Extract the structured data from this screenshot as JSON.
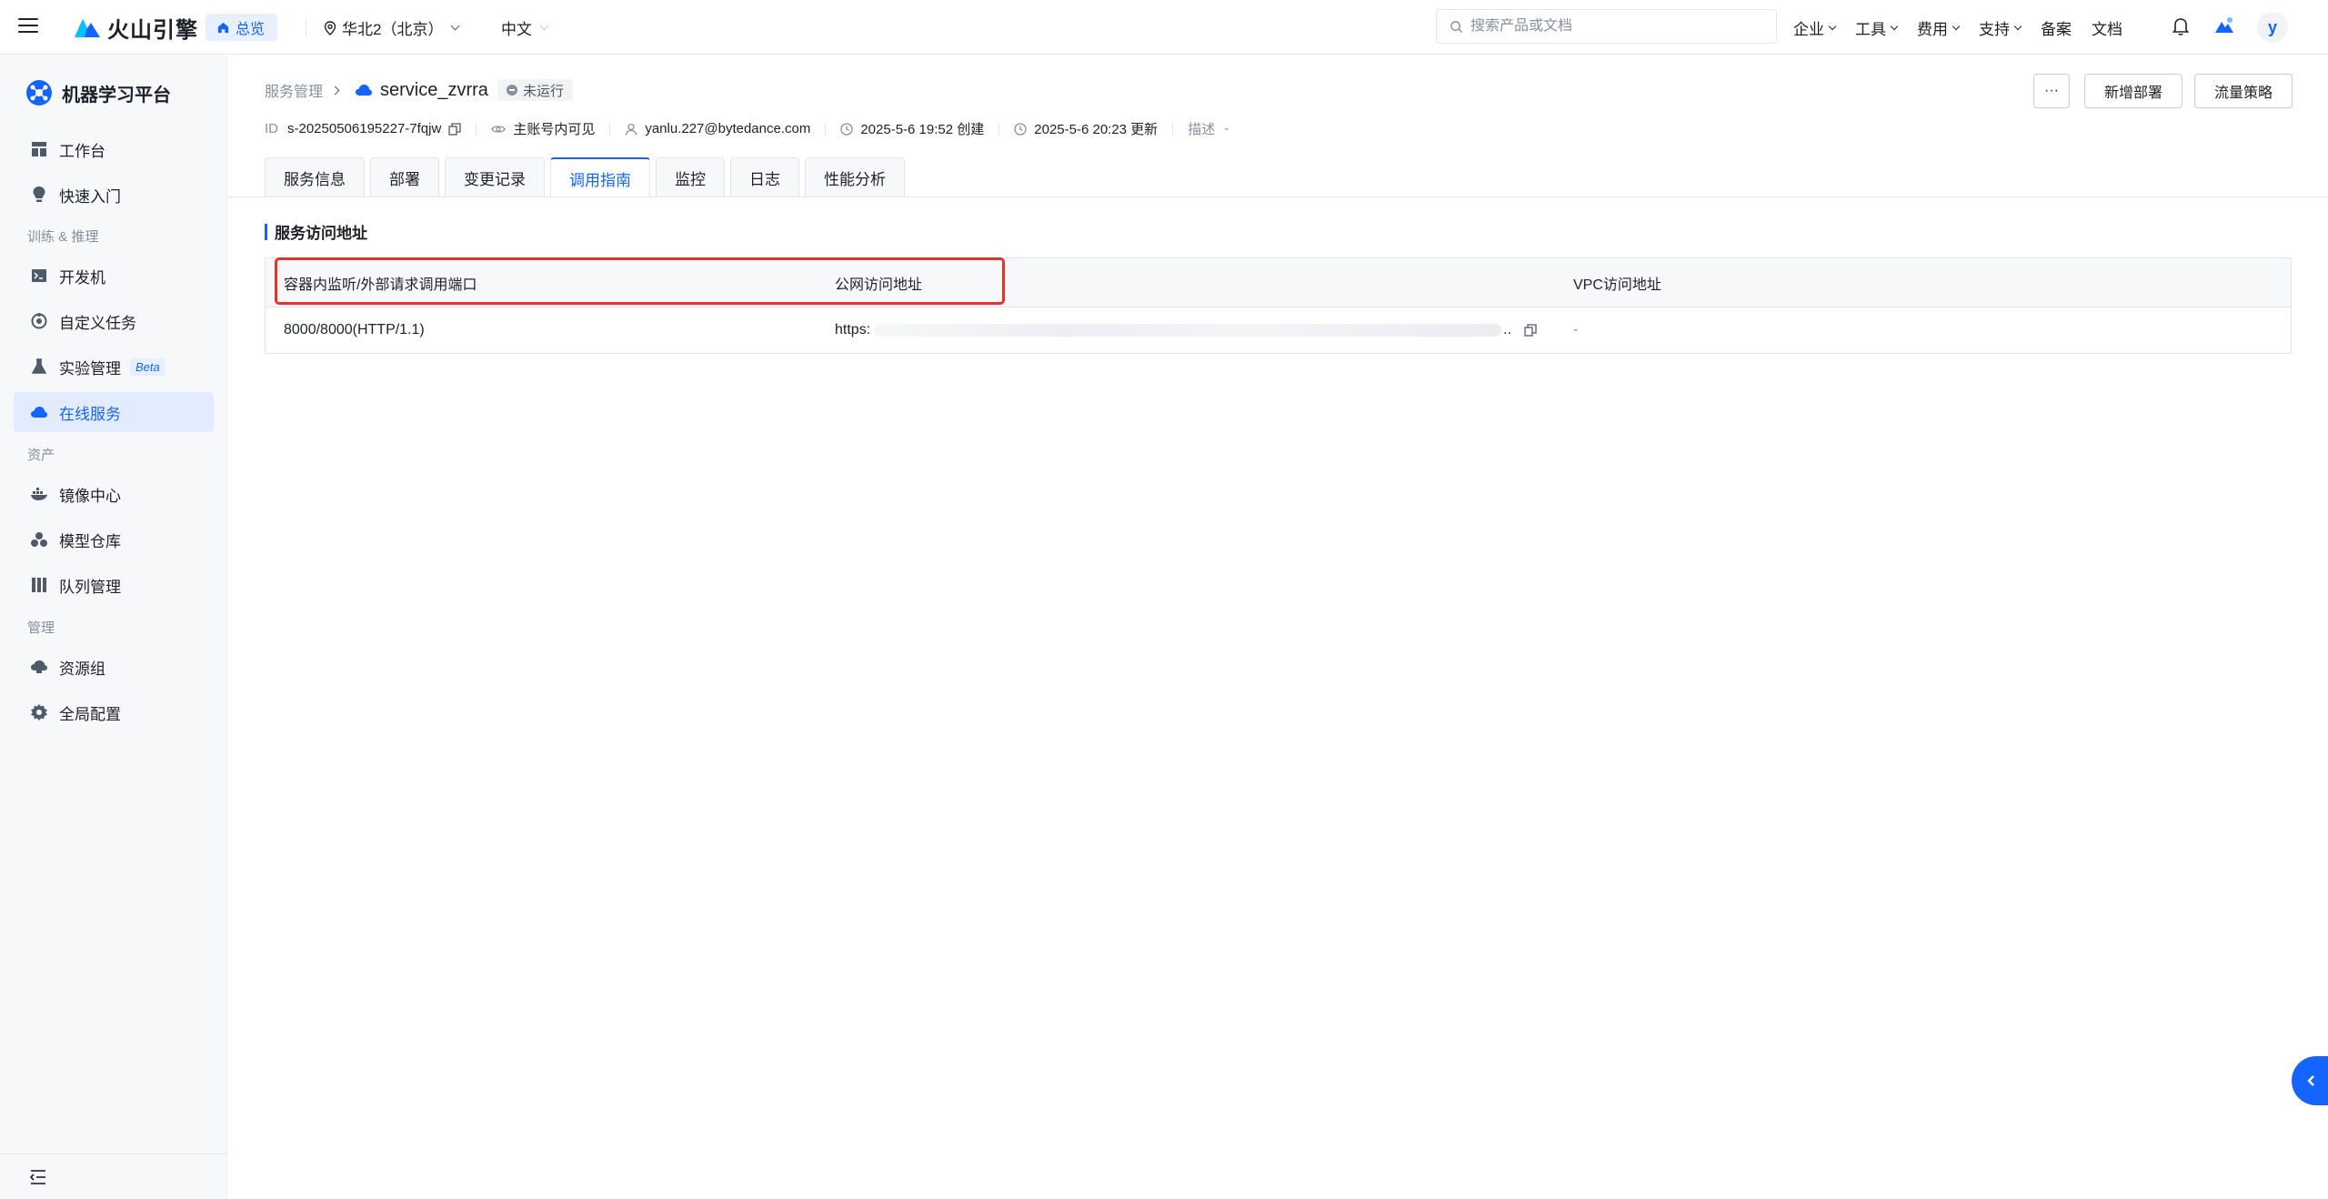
{
  "topbar": {
    "brand": "火山引擎",
    "home_label": "总览",
    "region": "华北2（北京）",
    "language": "中文",
    "search_placeholder": "搜索产品或文档",
    "links": [
      {
        "label": "企业",
        "has_dropdown": true
      },
      {
        "label": "工具",
        "has_dropdown": true
      },
      {
        "label": "费用",
        "has_dropdown": true
      },
      {
        "label": "支持",
        "has_dropdown": true
      },
      {
        "label": "备案",
        "has_dropdown": false
      },
      {
        "label": "文档",
        "has_dropdown": false
      }
    ],
    "avatar_letter": "y"
  },
  "sidebar": {
    "title": "机器学习平台",
    "items": [
      {
        "label": "工作台",
        "icon": "dashboard-icon"
      },
      {
        "label": "快速入门",
        "icon": "lightbulb-icon"
      },
      {
        "label": "开发机",
        "icon": "terminal-icon"
      },
      {
        "label": "自定义任务",
        "icon": "task-icon"
      },
      {
        "label": "实验管理",
        "icon": "flask-icon",
        "badge": "Beta"
      },
      {
        "label": "在线服务",
        "icon": "cloud-icon",
        "active": true
      },
      {
        "label": "镜像中心",
        "icon": "docker-icon"
      },
      {
        "label": "模型仓库",
        "icon": "cubes-icon"
      },
      {
        "label": "队列管理",
        "icon": "queue-icon"
      },
      {
        "label": "资源组",
        "icon": "resource-icon"
      },
      {
        "label": "全局配置",
        "icon": "gear-icon"
      }
    ],
    "groups": [
      "训练 & 推理",
      "资产",
      "管理"
    ]
  },
  "page": {
    "breadcrumb_parent": "服务管理",
    "service_name": "service_zvrra",
    "status": "未运行",
    "meta": {
      "id_label": "ID",
      "id_value": "s-20250506195227-7fqjw",
      "visibility": "主账号内可见",
      "owner": "yanlu.227@bytedance.com",
      "created": "2025-5-6 19:52 创建",
      "updated": "2025-5-6 20:23 更新",
      "desc_label": "描述",
      "desc_value": "-"
    },
    "buttons": {
      "more": "···",
      "new_deploy": "新增部署",
      "traffic_policy": "流量策略"
    },
    "tabs": [
      "服务信息",
      "部署",
      "变更记录",
      "调用指南",
      "监控",
      "日志",
      "性能分析"
    ],
    "active_tab": "调用指南",
    "section_title": "服务访问地址",
    "table": {
      "headers": [
        "容器内监听/外部请求调用端口",
        "公网访问地址",
        "VPC访问地址"
      ],
      "rows": [
        {
          "port": "8000/8000(HTTP/1.1)",
          "public_url_prefix": "https:",
          "public_url_suffix": "..",
          "vpc": "-"
        }
      ]
    }
  },
  "colors": {
    "accent": "#1664ff",
    "highlight_box": "#e0342d"
  }
}
